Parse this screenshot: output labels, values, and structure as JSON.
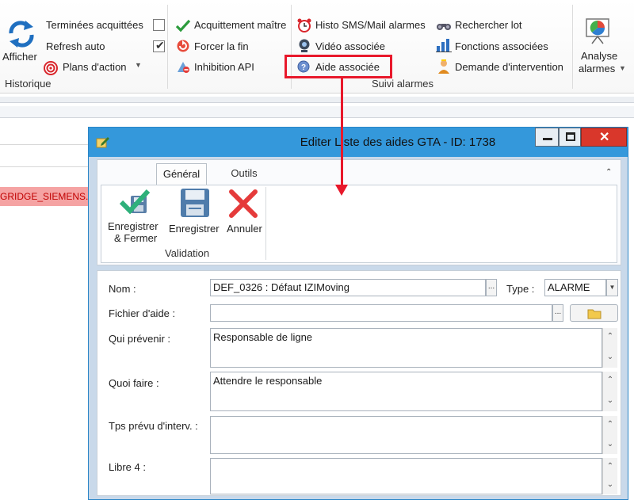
{
  "ribbon": {
    "afficher_label": "Afficher",
    "terminees_label": "Terminées acquittées",
    "refresh_label": "Refresh auto",
    "plans_label": "Plans d'action",
    "historique_group": "Historique",
    "acquittement_label": "Acquittement maître",
    "forcer_label": "Forcer la fin",
    "inhibition_label": "Inhibition API",
    "histo_label": "Histo SMS/Mail alarmes",
    "video_label": "Vidéo associée",
    "aide_label": "Aide associée",
    "suivi_group": "Suivi alarmes",
    "rechercher_label": "Rechercher lot",
    "fonctions_label": "Fonctions associées",
    "demande_label": "Demande d'intervention",
    "analyse_label": "Analyse",
    "alarmes_label": "alarmes"
  },
  "background": {
    "red_row_text": "GRIDGE_SIEMENS.D"
  },
  "dialog": {
    "title": "Editer Liste des aides GTA - ID: 1738",
    "tabs": [
      "Général",
      "Outils"
    ],
    "toolbar": {
      "save_close_label_1": "Enregistrer",
      "save_close_label_2": "& Fermer",
      "save_label": "Enregistrer",
      "cancel_label": "Annuler",
      "group_label": "Validation"
    },
    "form": {
      "nom_label": "Nom :",
      "nom_value": "DEF_0326 : Défaut IZIMoving",
      "type_label": "Type :",
      "type_value": "ALARME",
      "fichier_label": "Fichier d'aide :",
      "fichier_value": "",
      "qui_label": "Qui prévenir :",
      "qui_value": "Responsable de ligne",
      "quoi_label": "Quoi faire :",
      "quoi_value": "Attendre le responsable",
      "tps_label": "Tps prévu d'interv. :",
      "tps_value": "",
      "libre_label": "Libre 4 :",
      "libre_value": "",
      "ellipsis": "..."
    }
  },
  "colors": {
    "titlebar": "#3498db",
    "highlight": "#e8182b",
    "close_button": "#d9372b"
  }
}
